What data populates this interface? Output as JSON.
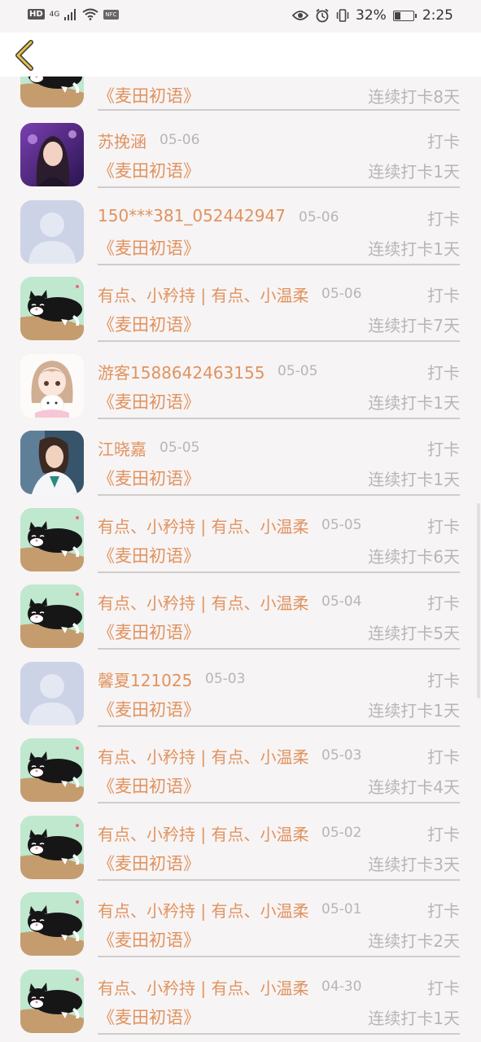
{
  "status_bar": {
    "hd": "HD",
    "network": "4G",
    "nfc": "NFC",
    "battery_percent_text": "32%",
    "battery_level": 0.32,
    "time": "2:25"
  },
  "header": {
    "back_icon": "chevron-left-icon",
    "accent_color": "#e8c04a"
  },
  "colors": {
    "name": "#e0935f",
    "muted": "#b8b5b5",
    "divider": "#cfcccc"
  },
  "top_partial": {
    "book": "《麦田初语》",
    "streak": "连续打卡8天",
    "avatar": "cat"
  },
  "rows": [
    {
      "name": "苏挽涵",
      "date": "05-06",
      "action": "打卡",
      "book": "《麦田初语》",
      "streak": "连续打卡1天",
      "avatar": "girl-purple"
    },
    {
      "name": "150***381_052442947",
      "date": "05-06",
      "action": "打卡",
      "book": "《麦田初语》",
      "streak": "连续打卡1天",
      "avatar": "default"
    },
    {
      "name": "有点、小矜持 | 有点、小温柔",
      "date": "05-06",
      "action": "打卡",
      "book": "《麦田初语》",
      "streak": "连续打卡7天",
      "avatar": "cat"
    },
    {
      "name": "游客1588642463155",
      "date": "05-05",
      "action": "打卡",
      "book": "《麦田初语》",
      "streak": "连续打卡1天",
      "avatar": "anime-girl"
    },
    {
      "name": "江晓嘉",
      "date": "05-05",
      "action": "打卡",
      "book": "《麦田初语》",
      "streak": "连续打卡1天",
      "avatar": "photo-woman"
    },
    {
      "name": "有点、小矜持 | 有点、小温柔",
      "date": "05-05",
      "action": "打卡",
      "book": "《麦田初语》",
      "streak": "连续打卡6天",
      "avatar": "cat"
    },
    {
      "name": "有点、小矜持 | 有点、小温柔",
      "date": "05-04",
      "action": "打卡",
      "book": "《麦田初语》",
      "streak": "连续打卡5天",
      "avatar": "cat"
    },
    {
      "name": "馨夏121025",
      "date": "05-03",
      "action": "打卡",
      "book": "《麦田初语》",
      "streak": "连续打卡1天",
      "avatar": "default"
    },
    {
      "name": "有点、小矜持 | 有点、小温柔",
      "date": "05-03",
      "action": "打卡",
      "book": "《麦田初语》",
      "streak": "连续打卡4天",
      "avatar": "cat"
    },
    {
      "name": "有点、小矜持 | 有点、小温柔",
      "date": "05-02",
      "action": "打卡",
      "book": "《麦田初语》",
      "streak": "连续打卡3天",
      "avatar": "cat"
    },
    {
      "name": "有点、小矜持 | 有点、小温柔",
      "date": "05-01",
      "action": "打卡",
      "book": "《麦田初语》",
      "streak": "连续打卡2天",
      "avatar": "cat"
    },
    {
      "name": "有点、小矜持 | 有点、小温柔",
      "date": "04-30",
      "action": "打卡",
      "book": "《麦田初语》",
      "streak": "连续打卡1天",
      "avatar": "cat"
    }
  ]
}
